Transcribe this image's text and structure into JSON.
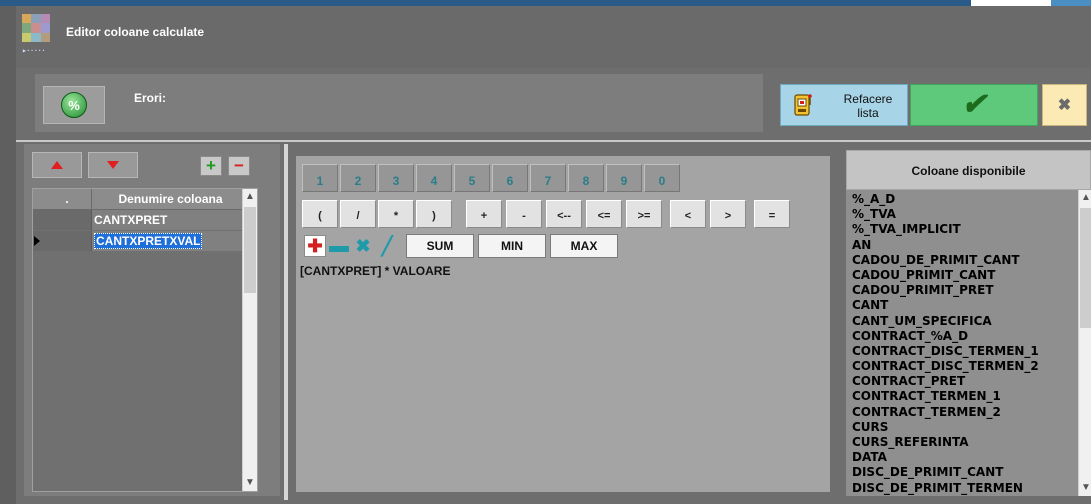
{
  "window": {
    "title": "Editor coloane calculate"
  },
  "errors": {
    "label": "Erori:",
    "percent_button": "%"
  },
  "toolbar": {
    "refresh_label_line1": "Refacere",
    "refresh_label_line2": "lista",
    "ok_symbol": "✔",
    "cancel_symbol": "✖"
  },
  "columns_grid": {
    "header_indicator": ".",
    "header_name": "Denumire coloana",
    "rows": [
      {
        "name": "CANTXPRET",
        "selected": false
      },
      {
        "name": "CANTXPRETXVAL",
        "selected": true
      }
    ],
    "move_up_icon": "arrow-up-icon",
    "move_down_icon": "arrow-down-icon",
    "add_symbol": "+",
    "remove_symbol": "−"
  },
  "expression_editor": {
    "digits": [
      "1",
      "2",
      "3",
      "4",
      "5",
      "6",
      "7",
      "8",
      "9",
      "0"
    ],
    "operators": [
      "(",
      "/",
      "*",
      ")",
      "+",
      "-",
      "<--",
      "<=",
      ">=",
      "<",
      ">",
      "="
    ],
    "functions": [
      "SUM",
      "MIN",
      "MAX"
    ],
    "formula": "[CANTXPRET] * VALOARE",
    "colors": {
      "add": "#d21f1f",
      "subtract": "#1f9aa8",
      "multiply": "#1f9aa8",
      "divide": "#1f9aa8"
    }
  },
  "available_columns": {
    "header": "Coloane disponibile",
    "items": [
      "%_A_D",
      "%_TVA",
      "%_TVA_IMPLICIT",
      "AN",
      "CADOU_DE_PRIMIT_CANT",
      "CADOU_PRIMIT_CANT",
      "CADOU_PRIMIT_PRET",
      "CANT",
      "CANT_UM_SPECIFICA",
      "CONTRACT_%A_D",
      "CONTRACT_DISC_TERMEN_1",
      "CONTRACT_DISC_TERMEN_2",
      "CONTRACT_PRET",
      "CONTRACT_TERMEN_1",
      "CONTRACT_TERMEN_2",
      "CURS",
      "CURS_REFERINTA",
      "DATA",
      "DISC_DE_PRIMIT_CANT",
      "DISC_DE_PRIMIT_TERMEN"
    ]
  }
}
